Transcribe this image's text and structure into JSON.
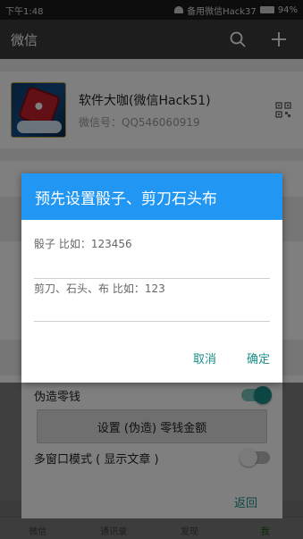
{
  "status_bar": {
    "time": "下午1:48",
    "carrier": "备用微信Hack37",
    "battery": "94%"
  },
  "header": {
    "title": "微信",
    "search_icon": "search-icon",
    "add_icon": "plus-icon"
  },
  "profile": {
    "name": "软件大咖(微信Hack51)",
    "wechat_id": "微信号：QQ546060919",
    "qr_icon": "qr-code-icon"
  },
  "dialog": {
    "title": "预先设置骰子、剪刀石头布",
    "dice_placeholder": "骰子 比如：123456",
    "rps_placeholder": "剪刀、石头、布 比如：123",
    "cancel_label": "取消",
    "ok_label": "确定"
  },
  "options": {
    "fake_change_label": "伪造零钱",
    "fake_change_on": true,
    "set_amount_label": "设置 (伪造) 零钱金额",
    "multi_window_label": "多窗口模式 ( 显示文章 )",
    "multi_window_on": false,
    "back_label": "返回"
  },
  "tabs": [
    {
      "label": "微信"
    },
    {
      "label": "通讯录"
    },
    {
      "label": "发现"
    },
    {
      "label": "我"
    }
  ],
  "colors": {
    "accent": "#2196f3",
    "teal": "#1a8e88",
    "wechat_green": "#1aad19"
  }
}
